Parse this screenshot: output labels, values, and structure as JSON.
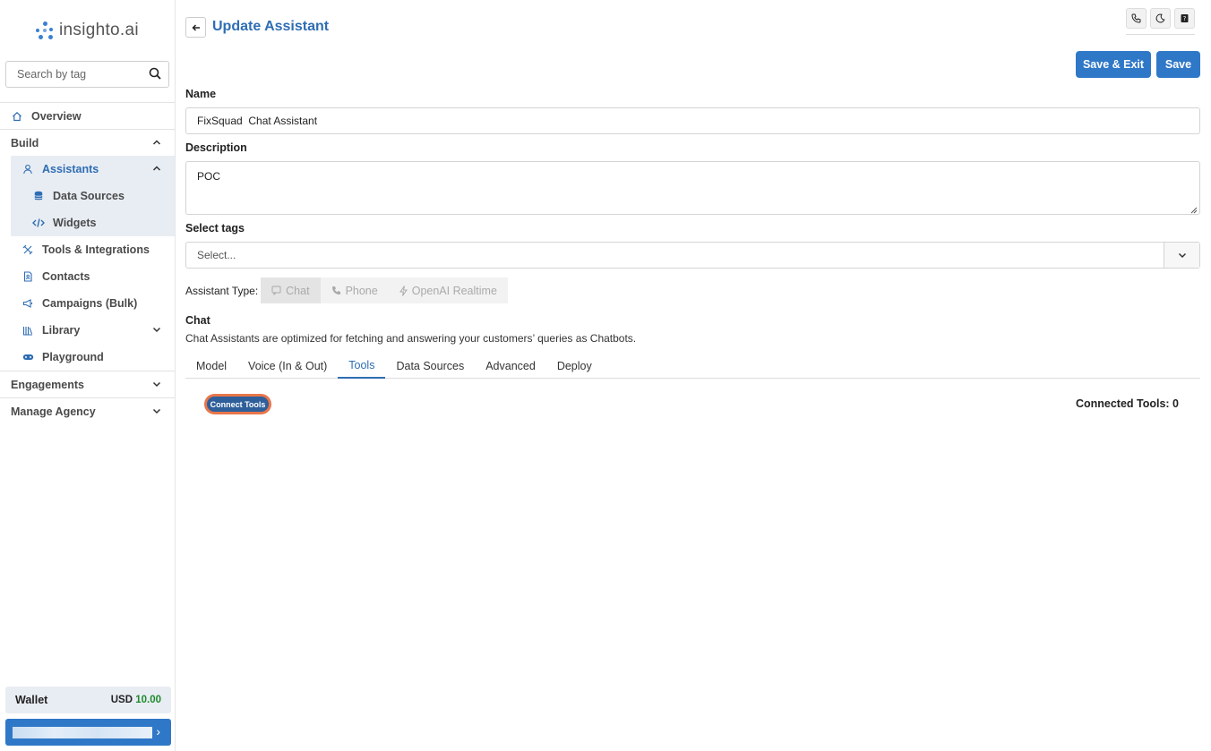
{
  "brand": {
    "name": "insighto.ai"
  },
  "sidebar": {
    "search_placeholder": "Search by tag",
    "items": {
      "overview": "Overview",
      "build": "Build",
      "assistants": "Assistants",
      "data_sources": "Data Sources",
      "widgets": "Widgets",
      "tools_integrations": "Tools & Integrations",
      "contacts": "Contacts",
      "campaigns": "Campaigns (Bulk)",
      "library": "Library",
      "playground": "Playground",
      "engagements": "Engagements",
      "manage_agency": "Manage Agency"
    },
    "wallet": {
      "label": "Wallet",
      "currency": "USD",
      "amount": "10.00"
    }
  },
  "header": {
    "title": "Update Assistant",
    "save_exit_label": "Save & Exit",
    "save_label": "Save"
  },
  "form": {
    "name_label": "Name",
    "name_value": "FixSquad  Chat Assistant",
    "description_label": "Description",
    "description_value": "POC",
    "tags_label": "Select tags",
    "tags_placeholder": "Select...",
    "assistant_type_label": "Assistant Type:",
    "assistant_types": [
      "Chat",
      "Phone",
      "OpenAI Realtime"
    ],
    "selected_type": "Chat"
  },
  "chat_section": {
    "title": "Chat",
    "description": "Chat Assistants are optimized for fetching and answering your customers’ queries as Chatbots."
  },
  "tabs": [
    "Model",
    "Voice (In & Out)",
    "Tools",
    "Data Sources",
    "Advanced",
    "Deploy"
  ],
  "active_tab": "Tools",
  "tools_panel": {
    "connect_label": "Connect Tools",
    "connected_label": "Connected Tools: 0"
  },
  "colors": {
    "accent": "#2f78c8",
    "title": "#2e6db4",
    "wallet_amount": "#1f8a2c",
    "highlight": "#e8764a"
  }
}
